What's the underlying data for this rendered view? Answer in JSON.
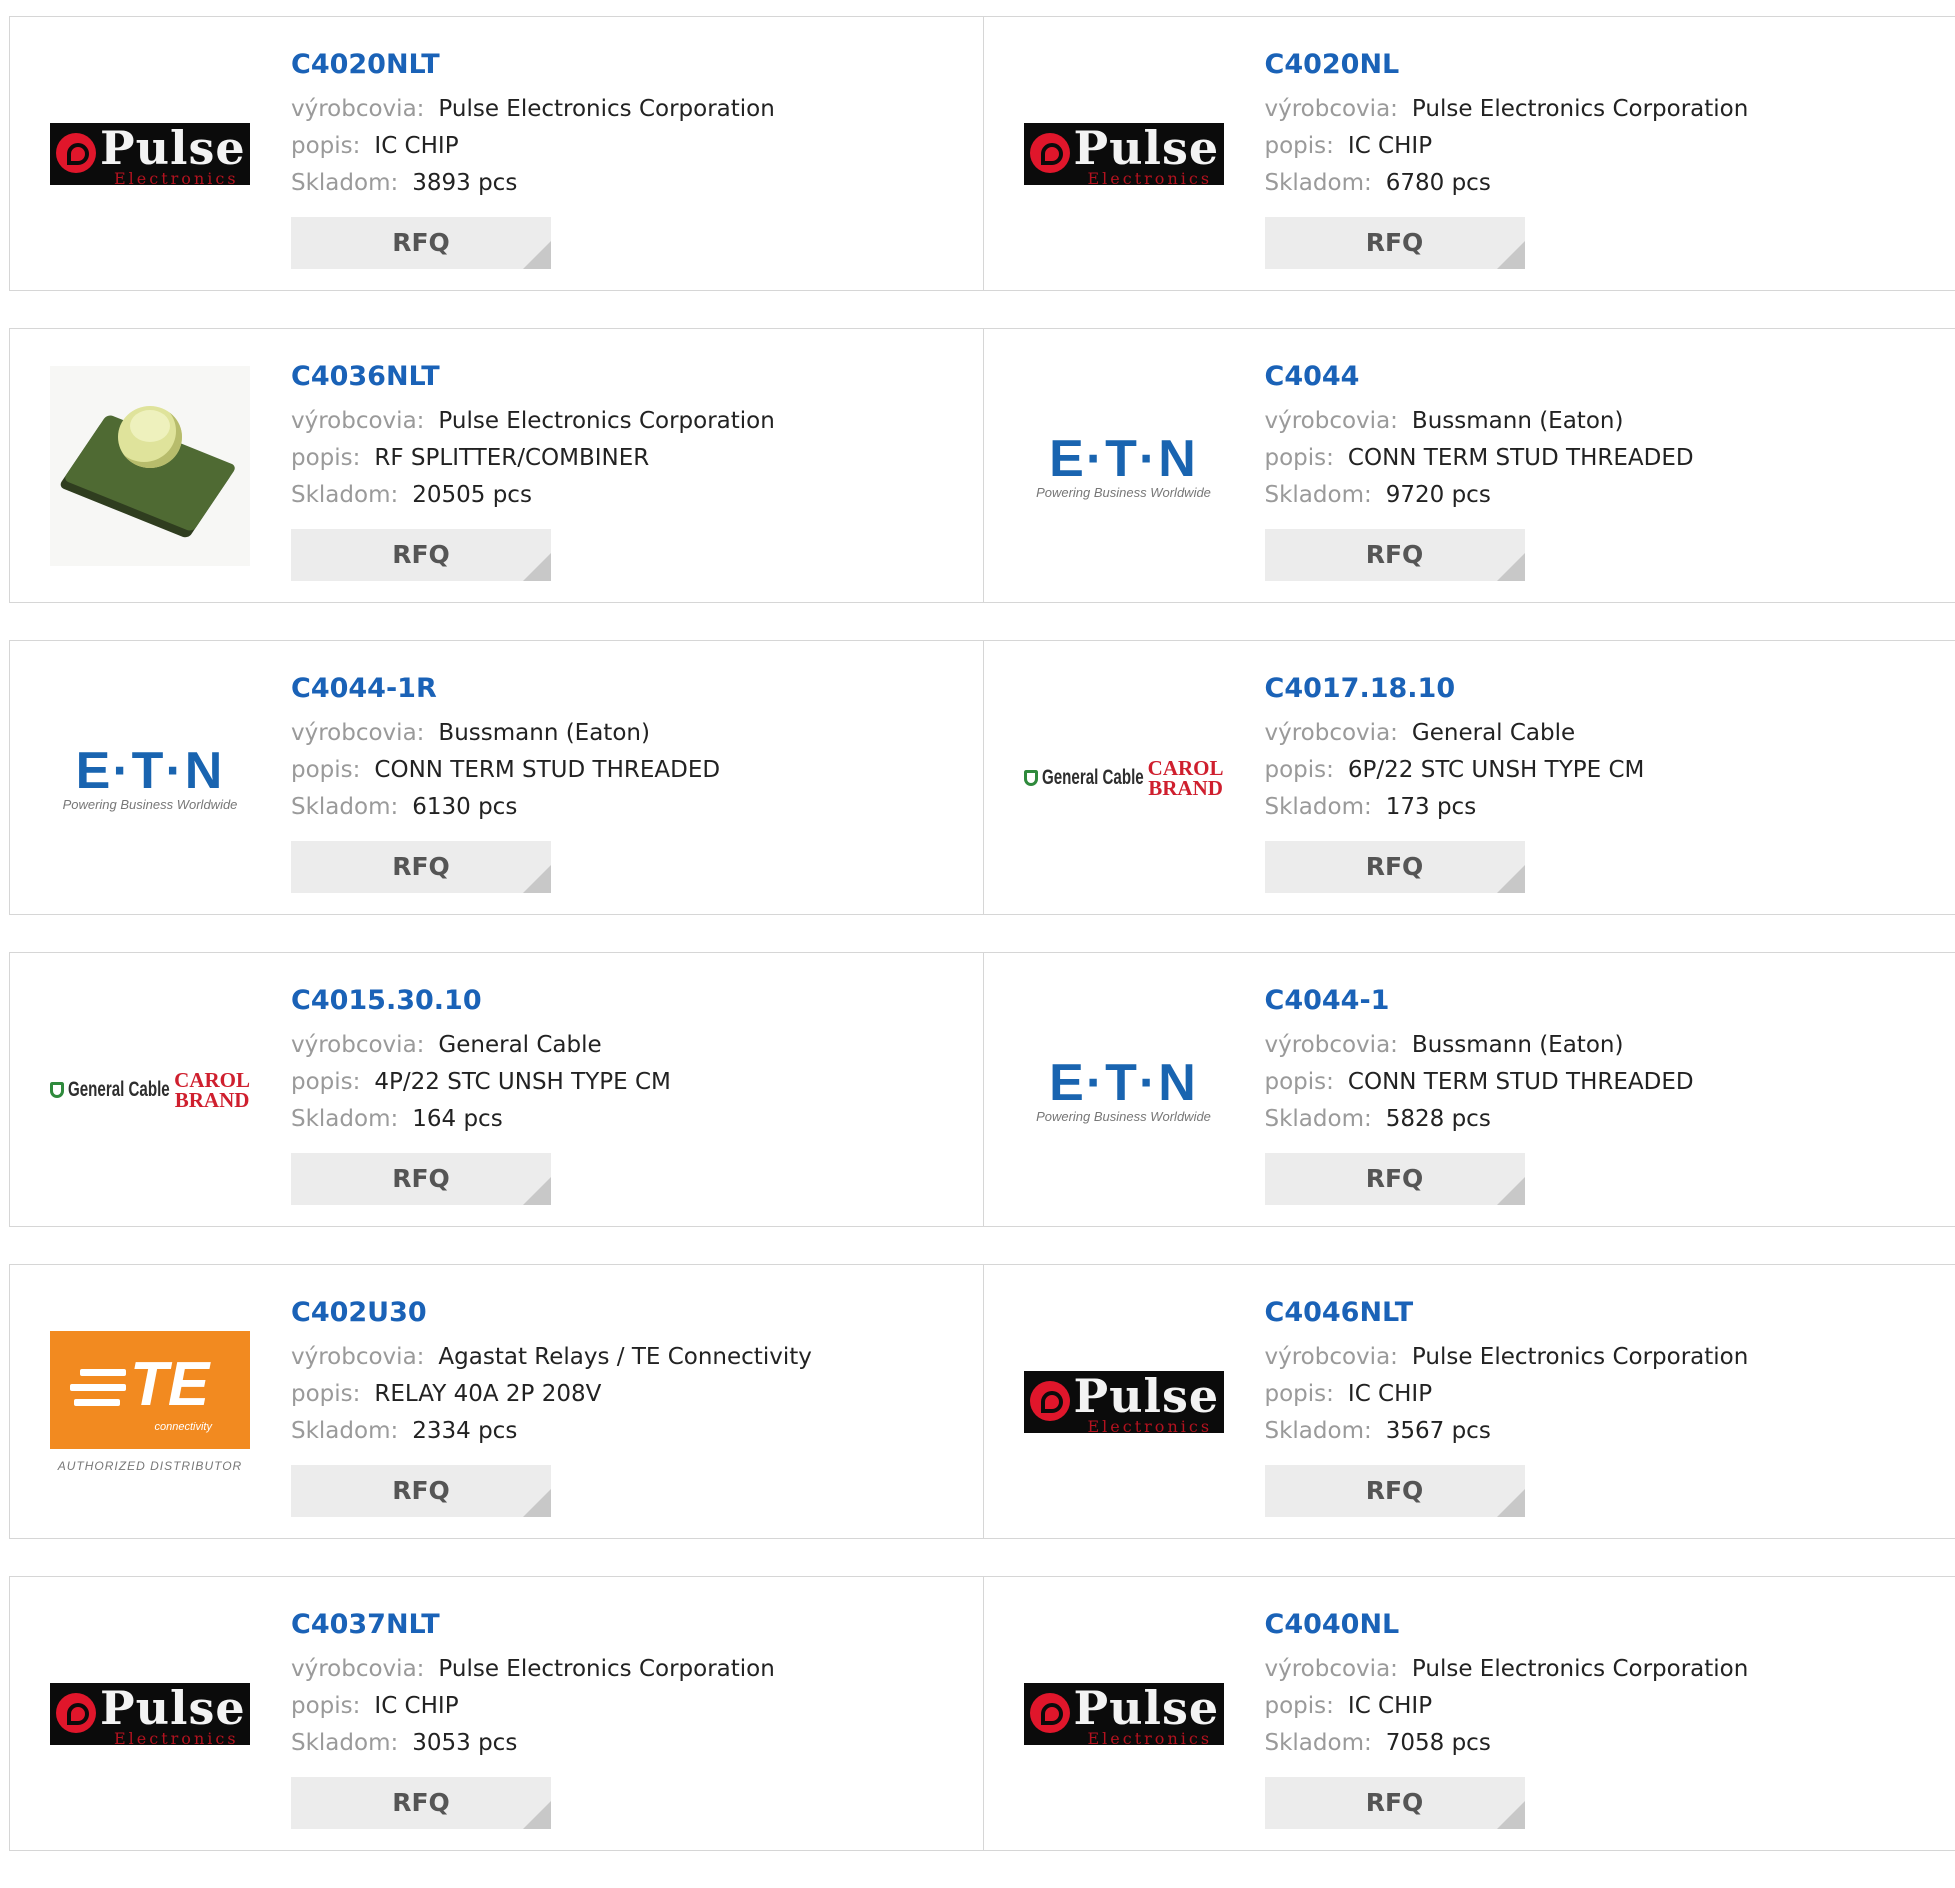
{
  "labels": {
    "manufacturer": "výrobcovia:",
    "description": "popis:",
    "stock": "Skladom:",
    "rfq": "RFQ"
  },
  "brand_logos": {
    "pulse": {
      "word": "Pulse",
      "sub": "Electronics"
    },
    "eaton": {
      "word": "E·T·N",
      "tag": "Powering Business Worldwide"
    },
    "general_cable": {
      "name": "General Cable",
      "carol": "CAROL",
      "brand": "BRAND"
    },
    "te": {
      "letters": "TE",
      "connectivity": "connectivity",
      "authorized": "AUTHORIZED DISTRIBUTOR"
    }
  },
  "colors": {
    "link": "#1a62b7",
    "pulse_red": "#e0162b",
    "eaton_blue": "#1964b0",
    "te_orange": "#f28a20",
    "gc_green": "#2f8a3c",
    "carol_red": "#cf1f2e"
  },
  "products": [
    {
      "part": "C4020NLT",
      "logo": "pulse",
      "manufacturer": "Pulse Electronics Corporation",
      "description": "IC CHIP",
      "stock": "3893 pcs"
    },
    {
      "part": "C4020NL",
      "logo": "pulse",
      "manufacturer": "Pulse Electronics Corporation",
      "description": "IC CHIP",
      "stock": "6780 pcs"
    },
    {
      "part": "C4036NLT",
      "logo": "photo",
      "manufacturer": "Pulse Electronics Corporation",
      "description": "RF SPLITTER/COMBINER",
      "stock": "20505 pcs"
    },
    {
      "part": "C4044",
      "logo": "eaton",
      "manufacturer": "Bussmann (Eaton)",
      "description": "CONN TERM STUD THREADED",
      "stock": "9720 pcs"
    },
    {
      "part": "C4044-1R",
      "logo": "eaton",
      "manufacturer": "Bussmann (Eaton)",
      "description": "CONN TERM STUD THREADED",
      "stock": "6130 pcs"
    },
    {
      "part": "C4017.18.10",
      "logo": "general_cable",
      "manufacturer": "General Cable",
      "description": "6P/22 STC UNSH TYPE CM",
      "stock": "173 pcs"
    },
    {
      "part": "C4015.30.10",
      "logo": "general_cable",
      "manufacturer": "General Cable",
      "description": "4P/22 STC UNSH TYPE CM",
      "stock": "164 pcs"
    },
    {
      "part": "C4044-1",
      "logo": "eaton",
      "manufacturer": "Bussmann (Eaton)",
      "description": "CONN TERM STUD THREADED",
      "stock": "5828 pcs"
    },
    {
      "part": "C402U30",
      "logo": "te",
      "manufacturer": "Agastat Relays / TE Connectivity",
      "description": "RELAY 40A 2P 208V",
      "stock": "2334 pcs"
    },
    {
      "part": "C4046NLT",
      "logo": "pulse",
      "manufacturer": "Pulse Electronics Corporation",
      "description": "IC CHIP",
      "stock": "3567 pcs"
    },
    {
      "part": "C4037NLT",
      "logo": "pulse",
      "manufacturer": "Pulse Electronics Corporation",
      "description": "IC CHIP",
      "stock": "3053 pcs"
    },
    {
      "part": "C4040NL",
      "logo": "pulse",
      "manufacturer": "Pulse Electronics Corporation",
      "description": "IC CHIP",
      "stock": "7058 pcs"
    }
  ]
}
